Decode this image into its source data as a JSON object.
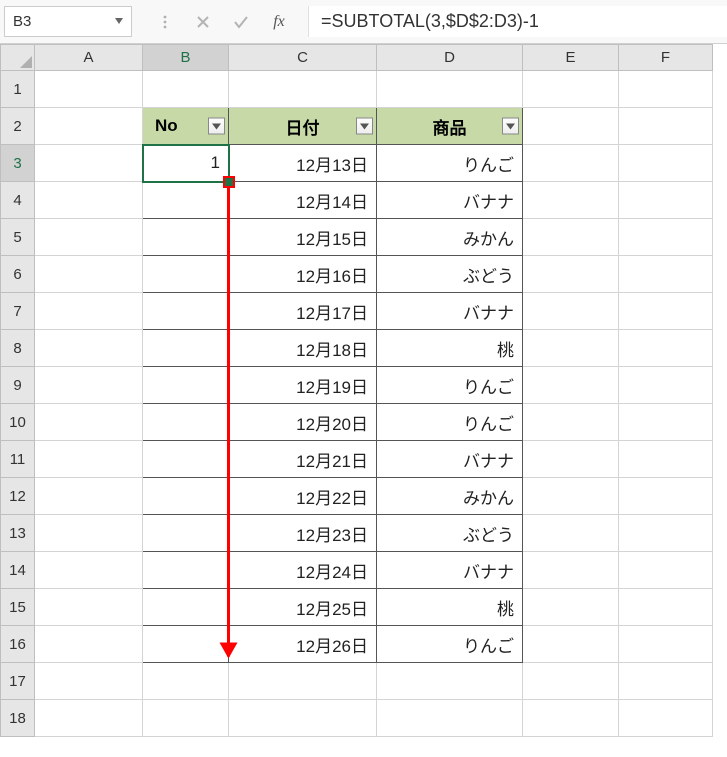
{
  "name_box": "B3",
  "formula": "=SUBTOTAL(3,$D$2:D3)-1",
  "fx_label": "fx",
  "columns": [
    "A",
    "B",
    "C",
    "D",
    "E",
    "F"
  ],
  "row_count": 18,
  "headers": {
    "b": "No",
    "c": "日付",
    "d": "商品"
  },
  "selected_value": "1",
  "data_rows": [
    {
      "c": "12月13日",
      "d": "りんご"
    },
    {
      "c": "12月14日",
      "d": "バナナ"
    },
    {
      "c": "12月15日",
      "d": "みかん"
    },
    {
      "c": "12月16日",
      "d": "ぶどう"
    },
    {
      "c": "12月17日",
      "d": "バナナ"
    },
    {
      "c": "12月18日",
      "d": "桃"
    },
    {
      "c": "12月19日",
      "d": "りんご"
    },
    {
      "c": "12月20日",
      "d": "りんご"
    },
    {
      "c": "12月21日",
      "d": "バナナ"
    },
    {
      "c": "12月22日",
      "d": "みかん"
    },
    {
      "c": "12月23日",
      "d": "ぶどう"
    },
    {
      "c": "12月24日",
      "d": "バナナ"
    },
    {
      "c": "12月25日",
      "d": "桃"
    },
    {
      "c": "12月26日",
      "d": "りんご"
    }
  ],
  "annotation": {
    "fill_handle_cell": "B3",
    "arrow_to_row": 16,
    "color": "#ff0000"
  }
}
